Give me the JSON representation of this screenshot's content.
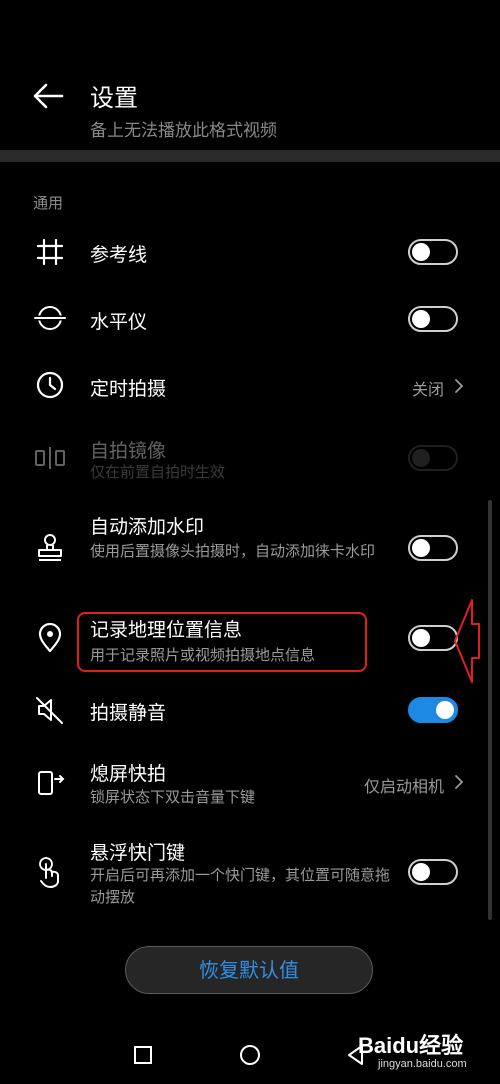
{
  "header": {
    "title": "设置",
    "clipped_text": "备上无法播放此格式视频"
  },
  "section": {
    "label": "通用"
  },
  "items": [
    {
      "label": "参考线",
      "icon": "grid-icon",
      "toggle": "off"
    },
    {
      "label": "水平仪",
      "icon": "level-icon",
      "toggle": "off"
    },
    {
      "label": "定时拍摄",
      "icon": "timer-icon",
      "value": "关闭"
    },
    {
      "label": "自拍镜像",
      "sublabel": "仅在前置自拍时生效",
      "icon": "mirror-icon",
      "toggle": "off",
      "disabled": true
    },
    {
      "label": "自动添加水印",
      "sublabel": "使用后置摄像头拍摄时，自动添加徕卡水印",
      "icon": "stamp-icon",
      "toggle": "off"
    },
    {
      "label": "记录地理位置信息",
      "sublabel": "用于记录照片或视频拍摄地点信息",
      "icon": "location-icon",
      "toggle": "off"
    },
    {
      "label": "拍摄静音",
      "icon": "mute-icon",
      "toggle": "on"
    },
    {
      "label": "熄屏快拍",
      "sublabel": "锁屏状态下双击音量下键",
      "icon": "snapshot-icon",
      "value": "仅启动相机"
    },
    {
      "label": "悬浮快门键",
      "sublabel": "开启后可再添加一个快门键，其位置可随意拖动摆放",
      "icon": "touch-icon",
      "toggle": "off"
    }
  ],
  "reset_button": {
    "label": "恢复默认值"
  },
  "watermark": {
    "title": "Baidu经验",
    "subtitle": "jingyan.baidu.com"
  },
  "colors": {
    "accent": "#1e88e5",
    "highlight": "#e02020",
    "background": "#000000"
  }
}
